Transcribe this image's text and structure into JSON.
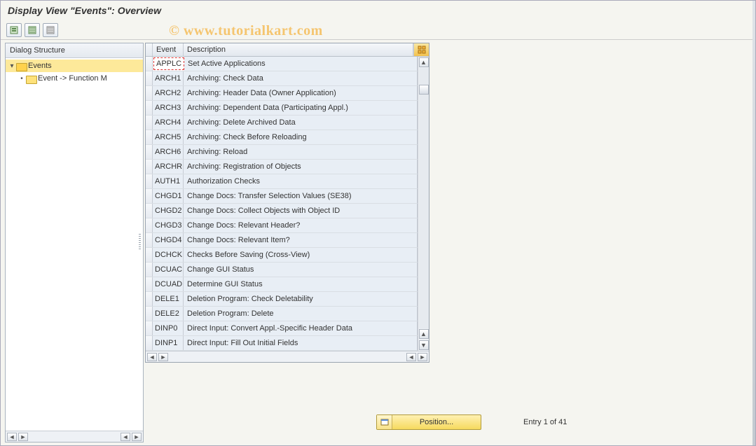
{
  "title": "Display View \"Events\": Overview",
  "watermark": "© www.tutorialkart.com",
  "toolbar": {
    "btn1": "display-details",
    "btn2": "expand-all",
    "btn3": "collapse-all"
  },
  "dialog_structure": {
    "header": "Dialog Structure",
    "root": {
      "label": "Events"
    },
    "child": {
      "label": "Event -> Function M"
    }
  },
  "grid": {
    "col_event": "Event",
    "col_desc": "Description",
    "rows": [
      {
        "event": "APPLC",
        "desc": "Set Active Applications"
      },
      {
        "event": "ARCH1",
        "desc": "Archiving: Check Data"
      },
      {
        "event": "ARCH2",
        "desc": "Archiving: Header Data (Owner Application)"
      },
      {
        "event": "ARCH3",
        "desc": "Archiving: Dependent Data (Participating Appl.)"
      },
      {
        "event": "ARCH4",
        "desc": "Archiving: Delete Archived Data"
      },
      {
        "event": "ARCH5",
        "desc": "Archiving: Check Before Reloading"
      },
      {
        "event": "ARCH6",
        "desc": "Archiving: Reload"
      },
      {
        "event": "ARCHR",
        "desc": "Archiving: Registration of Objects"
      },
      {
        "event": "AUTH1",
        "desc": "Authorization Checks"
      },
      {
        "event": "CHGD1",
        "desc": "Change Docs: Transfer Selection Values (SE38)"
      },
      {
        "event": "CHGD2",
        "desc": "Change Docs: Collect Objects with Object ID"
      },
      {
        "event": "CHGD3",
        "desc": "Change Docs: Relevant Header?"
      },
      {
        "event": "CHGD4",
        "desc": "Change Docs: Relevant Item?"
      },
      {
        "event": "DCHCK",
        "desc": "Checks Before Saving (Cross-View)"
      },
      {
        "event": "DCUAC",
        "desc": "Change GUI Status"
      },
      {
        "event": "DCUAD",
        "desc": "Determine GUI Status"
      },
      {
        "event": "DELE1",
        "desc": "Deletion Program: Check Deletability"
      },
      {
        "event": "DELE2",
        "desc": "Deletion Program: Delete"
      },
      {
        "event": "DINP0",
        "desc": "Direct Input: Convert Appl.-Specific Header Data"
      },
      {
        "event": "DINP1",
        "desc": "Direct Input: Fill Out Initial Fields"
      }
    ]
  },
  "footer": {
    "position_label": "Position...",
    "entry_text": "Entry 1 of 41"
  }
}
